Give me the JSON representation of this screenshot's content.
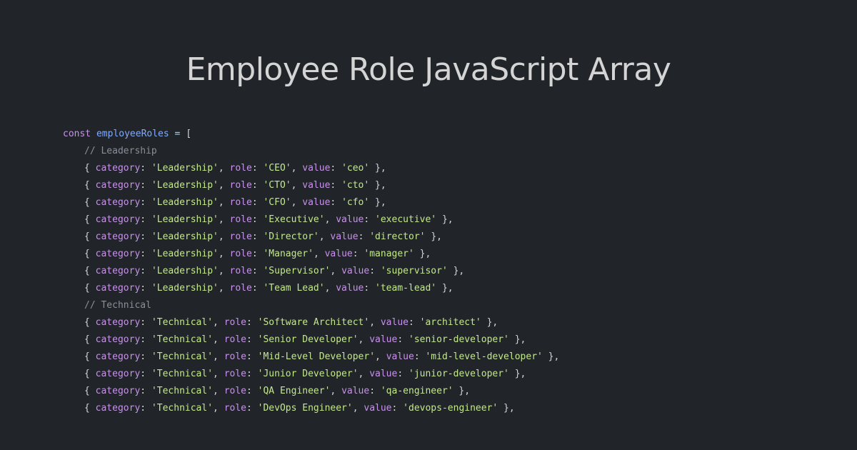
{
  "page": {
    "title": "Employee Role JavaScript Array"
  },
  "code": {
    "declaration": {
      "keyword": "const",
      "name": "employeeRoles",
      "operator": "=",
      "open": "["
    },
    "items": [
      {
        "type": "comment",
        "text": "// Leadership"
      },
      {
        "type": "entry",
        "category": "'Leadership'",
        "role": "'CEO'",
        "value": "'ceo'"
      },
      {
        "type": "entry",
        "category": "'Leadership'",
        "role": "'CTO'",
        "value": "'cto'"
      },
      {
        "type": "entry",
        "category": "'Leadership'",
        "role": "'CFO'",
        "value": "'cfo'"
      },
      {
        "type": "entry",
        "category": "'Leadership'",
        "role": "'Executive'",
        "value": "'executive'"
      },
      {
        "type": "entry",
        "category": "'Leadership'",
        "role": "'Director'",
        "value": "'director'"
      },
      {
        "type": "entry",
        "category": "'Leadership'",
        "role": "'Manager'",
        "value": "'manager'"
      },
      {
        "type": "entry",
        "category": "'Leadership'",
        "role": "'Supervisor'",
        "value": "'supervisor'"
      },
      {
        "type": "entry",
        "category": "'Leadership'",
        "role": "'Team Lead'",
        "value": "'team-lead'"
      },
      {
        "type": "comment",
        "text": "// Technical"
      },
      {
        "type": "entry",
        "category": "'Technical'",
        "role": "'Software Architect'",
        "value": "'architect'"
      },
      {
        "type": "entry",
        "category": "'Technical'",
        "role": "'Senior Developer'",
        "value": "'senior-developer'"
      },
      {
        "type": "entry",
        "category": "'Technical'",
        "role": "'Mid-Level Developer'",
        "value": "'mid-level-developer'"
      },
      {
        "type": "entry",
        "category": "'Technical'",
        "role": "'Junior Developer'",
        "value": "'junior-developer'"
      },
      {
        "type": "entry",
        "category": "'Technical'",
        "role": "'QA Engineer'",
        "value": "'qa-engineer'"
      },
      {
        "type": "entry",
        "category": "'Technical'",
        "role": "'DevOps Engineer'",
        "value": "'devops-engineer'"
      }
    ]
  },
  "syntax": {
    "keys": {
      "category": "category",
      "role": "role",
      "value": "value"
    },
    "colors": {
      "background": "#212529",
      "title": "#d4d4d4",
      "keyword": "#c792ea",
      "identifier": "#82aaff",
      "operator": "#89ddff",
      "string": "#c3e88d",
      "comment": "#8a8f98",
      "punctuation": "#d4d4d4"
    }
  }
}
